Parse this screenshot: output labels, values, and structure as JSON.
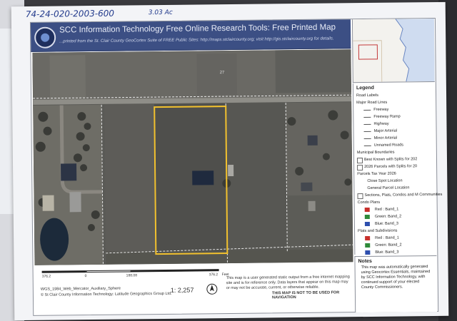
{
  "handwritten": {
    "parcel_number": "74-24-020-2003-600",
    "acreage": "3.03 Ac"
  },
  "header": {
    "title": "SCC Information Technology Free Online Research Tools: Free Printed Map",
    "subtitle": "...printed from the St. Clair County GeoCortex Suite of FREE Public Sites: http://maps.stclaircounty.org; visit http://gis.stclaircounty.org for details."
  },
  "map": {
    "parcel_labels": [
      "27",
      ""
    ]
  },
  "legend": {
    "title": "Legend",
    "items": [
      {
        "label": "Road Labels",
        "kind": "text"
      },
      {
        "label": "Major Road Lines",
        "kind": "text"
      },
      {
        "label": "Freeway",
        "kind": "line",
        "indent": true,
        "color": "#555555"
      },
      {
        "label": "Freeway Ramp",
        "kind": "line",
        "indent": true,
        "color": "#555555"
      },
      {
        "label": "Highway",
        "kind": "line",
        "indent": true,
        "color": "#555555"
      },
      {
        "label": "Major Arterial",
        "kind": "line",
        "indent": true,
        "color": "#555555"
      },
      {
        "label": "Minor Arterial",
        "kind": "line",
        "indent": true,
        "color": "#555555"
      },
      {
        "label": "Unnamed Roads",
        "kind": "line",
        "indent": true,
        "color": "#555555"
      },
      {
        "label": "Municipal Boundaries",
        "kind": "text"
      },
      {
        "label": "Best Known with Splits for 202",
        "kind": "box"
      },
      {
        "label": "2026 Parcels with Splits for 20",
        "kind": "box"
      },
      {
        "label": "Parcels Tax Year 2026",
        "kind": "text"
      },
      {
        "label": "Close Spot Location",
        "kind": "text",
        "indent": true
      },
      {
        "label": "General Parcel Location",
        "kind": "text",
        "indent": true
      },
      {
        "label": "Sections, Plats, Condos and M Communities",
        "kind": "box"
      },
      {
        "label": "Condo Plans",
        "kind": "text"
      },
      {
        "label": "Red : Band_1",
        "kind": "swatch",
        "indent": true,
        "color": "#c8302c"
      },
      {
        "label": "Green: Band_2",
        "kind": "swatch",
        "indent": true,
        "color": "#2f8a3a"
      },
      {
        "label": "Blue: Band_3",
        "kind": "swatch",
        "indent": true,
        "color": "#2e4fae"
      },
      {
        "label": "Plats and Subdivisions",
        "kind": "text"
      },
      {
        "label": "Red : Band_1",
        "kind": "swatch",
        "indent": true,
        "color": "#c8302c"
      },
      {
        "label": "Green: Band_2",
        "kind": "swatch",
        "indent": true,
        "color": "#2f8a3a"
      },
      {
        "label": "Blue: Band_3",
        "kind": "swatch",
        "indent": true,
        "color": "#2e4fae"
      }
    ]
  },
  "notes": {
    "title": "Notes",
    "body": "This map was automatically generated using Geocortex Essentials, maintained by SCC Information Technology, with continued support of your elected County Commissioners."
  },
  "footer": {
    "scale_labels": [
      "376.2",
      "0",
      "188.08",
      "376.2",
      "Feet"
    ],
    "projection": "WGS_1984_Web_Mercator_Auxiliary_Sphere",
    "copyright": "© St Clair County Information Technology: Latitude Geographics Group Ltd.",
    "scale": "1: 2,257",
    "disclaimer": "This map is a user generated static output from a free internet mapping site and is for reference only. Data layers that appear on this map may or may not be accurate, current, or otherwise reliable.",
    "do_not_use": "THIS MAP IS NOT TO BE USED FOR NAVIGATION"
  },
  "colors": {
    "header_bg": "#3c4f84",
    "parcel_outline": "#f2c12e",
    "handwriting": "#223a8c"
  }
}
